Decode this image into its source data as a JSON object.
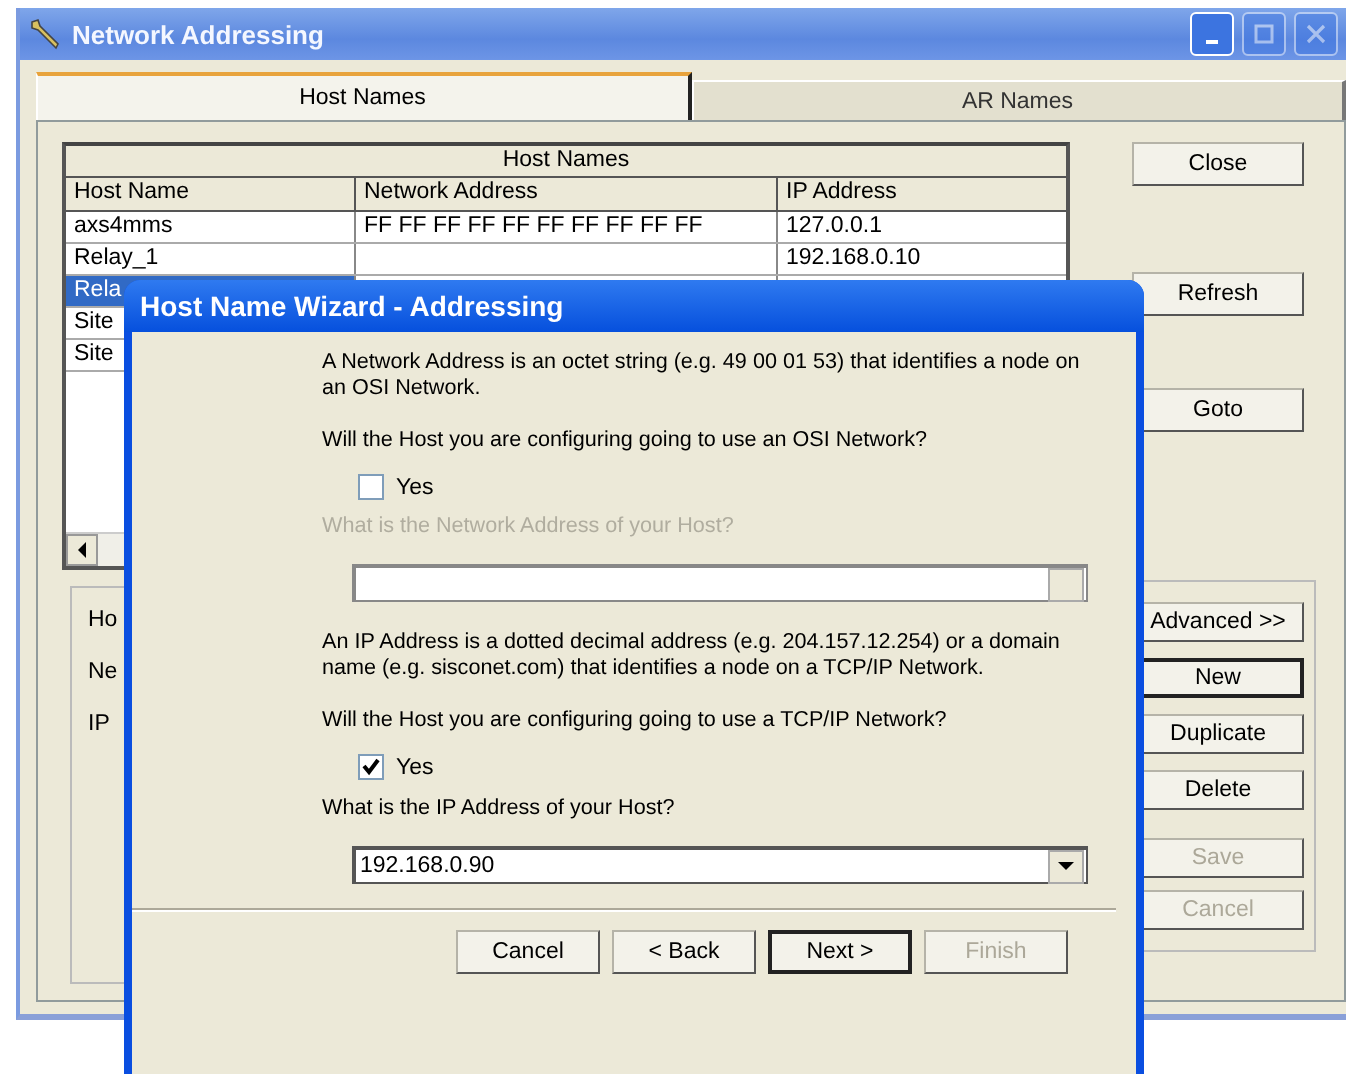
{
  "window": {
    "title": "Network Addressing"
  },
  "tabs": [
    {
      "label": "Host Names",
      "selected": true
    },
    {
      "label": "AR Names",
      "selected": false
    }
  ],
  "table": {
    "caption": "Host Names",
    "columns": [
      "Host Name",
      "Network Address",
      "IP Address"
    ],
    "rows": [
      {
        "host_name": "axs4mms",
        "network_address": "FF FF FF FF FF FF FF FF FF FF",
        "ip_address": "127.0.0.1",
        "selected": false
      },
      {
        "host_name": "Relay_1",
        "ip_address": "192.168.0.10",
        "selected": false
      },
      {
        "host_name": "Rela",
        "selected": true
      },
      {
        "host_name": "Site",
        "selected": false
      },
      {
        "host_name": "Site",
        "selected": false
      }
    ]
  },
  "details": {
    "labels": [
      "Ho",
      "Ne",
      "IP"
    ]
  },
  "side_buttons": [
    {
      "label": "Close",
      "disabled": false,
      "default": false
    },
    {
      "label": "Refresh",
      "disabled": false,
      "default": false
    },
    {
      "label": "Goto",
      "disabled": false,
      "default": false
    }
  ],
  "action_buttons": [
    {
      "label": "Advanced >>",
      "disabled": false,
      "default": false
    },
    {
      "label": "New",
      "disabled": false,
      "default": true
    },
    {
      "label": "Duplicate",
      "disabled": false,
      "default": false
    },
    {
      "label": "Delete",
      "disabled": false,
      "default": false
    },
    {
      "label": "Save",
      "disabled": true,
      "default": false
    },
    {
      "label": "Cancel",
      "disabled": true,
      "default": false
    }
  ],
  "wizard": {
    "title": "Host Name Wizard - Addressing",
    "osi_info": "A Network Address is an octet string (e.g. 49 00 01 53) that identifies a node on an OSI Network.",
    "osi_question": "Will the Host you are configuring going to use an OSI Network?",
    "osi_checkbox": {
      "label": "Yes",
      "checked": false
    },
    "osi_prompt": "What is the Network Address of your Host?",
    "ip_info": "An IP Address is a dotted decimal address (e.g. 204.157.12.254) or a domain name (e.g. sisconet.com) that identifies a node on a TCP/IP Network.",
    "ip_question": "Will the Host you are configuring going to use a TCP/IP Network?",
    "ip_checkbox": {
      "label": "Yes",
      "checked": true
    },
    "ip_prompt": "What is the IP Address of your Host?",
    "ip_value": "192.168.0.90",
    "buttons": [
      {
        "label": "Cancel",
        "disabled": false,
        "default": false
      },
      {
        "label": "< Back",
        "disabled": false,
        "default": false
      },
      {
        "label": "Next >",
        "disabled": false,
        "default": true
      },
      {
        "label": "Finish",
        "disabled": true,
        "default": false
      }
    ]
  }
}
